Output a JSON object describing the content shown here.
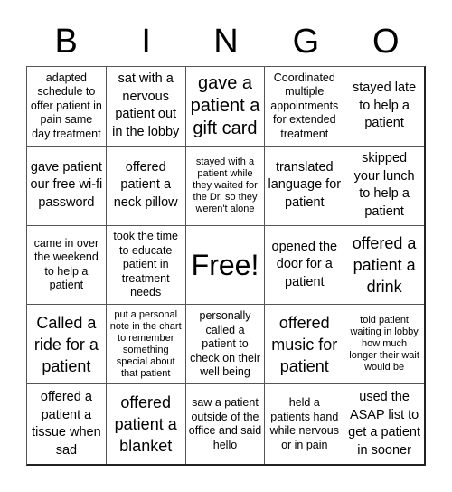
{
  "header": {
    "letters": [
      "B",
      "I",
      "N",
      "G",
      "O"
    ]
  },
  "cells": [
    {
      "text": "adapted schedule to offer patient in pain same day treatment",
      "size": "s-sm"
    },
    {
      "text": "sat with a nervous patient out in the lobby",
      "size": "s-md"
    },
    {
      "text": "gave a patient a gift card",
      "size": "s-xl"
    },
    {
      "text": "Coordinated multiple appointments for extended treatment",
      "size": "s-sm"
    },
    {
      "text": "stayed late to help a patient",
      "size": "s-md"
    },
    {
      "text": "gave patient our free wi-fi password",
      "size": "s-md"
    },
    {
      "text": "offered patient a neck pillow",
      "size": "s-md"
    },
    {
      "text": "stayed with a patient while they waited for the Dr, so they weren't alone",
      "size": "s-xs"
    },
    {
      "text": "translated language for patient",
      "size": "s-md"
    },
    {
      "text": "skipped your lunch to help a patient",
      "size": "s-md"
    },
    {
      "text": "came in over the weekend to help a patient",
      "size": "s-sm"
    },
    {
      "text": "took the time to educate patient in treatment needs",
      "size": "s-sm"
    },
    {
      "text": "Free!",
      "size": "s-free"
    },
    {
      "text": "opened the door for a patient",
      "size": "s-md"
    },
    {
      "text": "offered a patient a drink",
      "size": "s-lg"
    },
    {
      "text": "Called a ride for a patient",
      "size": "s-lg"
    },
    {
      "text": "put a personal note in the chart to remember something special about that patient",
      "size": "s-xs"
    },
    {
      "text": "personally called a patient to check on their well being",
      "size": "s-sm"
    },
    {
      "text": "offered music for patient",
      "size": "s-lg"
    },
    {
      "text": "told patient waiting in lobby how much longer their wait would be",
      "size": "s-xs"
    },
    {
      "text": "offered a patient a tissue when sad",
      "size": "s-md"
    },
    {
      "text": "offered patient a blanket",
      "size": "s-lg"
    },
    {
      "text": "saw a patient outside of the office and said hello",
      "size": "s-sm"
    },
    {
      "text": "held a patients hand while nervous or in pain",
      "size": "s-sm"
    },
    {
      "text": "used the ASAP list to get a patient in sooner",
      "size": "s-md"
    }
  ]
}
